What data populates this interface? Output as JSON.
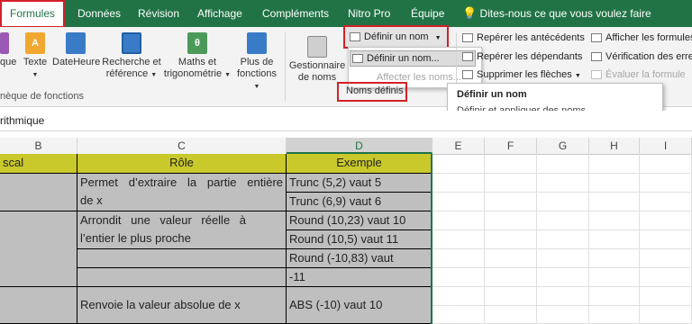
{
  "tabs": [
    "Formules",
    "Données",
    "Révision",
    "Affichage",
    "Compléments",
    "Nitro Pro",
    "Équipe"
  ],
  "tell_me": "Dites-nous ce que vous voulez faire",
  "ribbon": {
    "lib_buttons": [
      "que",
      "Texte",
      "DateHeure",
      "Recherche et",
      "référence",
      "Maths et",
      "trigonométrie",
      "Plus de",
      "fonctions"
    ],
    "lib_group_label": "nèque de fonctions",
    "name_manager": [
      "Gestionnaire",
      "de noms"
    ],
    "define_name": "Définir un nom",
    "define_name_item": "Définir un nom...",
    "apply_names": "Affecter les noms...",
    "defined_names_label": "Noms définis",
    "audit": [
      "Repérer les antécédents",
      "Repérer les dépendants",
      "Supprimer les flèches",
      "Afficher les formules",
      "Vérification des erreurs",
      "Évaluer la formule"
    ]
  },
  "tooltip": {
    "title": "Définir un nom",
    "body": "Définir et appliquer des noms."
  },
  "formula_bar": "rithmique",
  "columns": [
    "B",
    "C",
    "D",
    "E",
    "F",
    "G",
    "H",
    "I"
  ],
  "table": {
    "headers": [
      "scal",
      "Rôle",
      "Exemple"
    ],
    "roles": [
      "Permet d’extraire la partie entière",
      "de x",
      "Arrondit une valeur réelle à",
      "l’entier le plus proche",
      "Renvoie la valeur absolue de x"
    ],
    "examples": [
      "Trunc (5,2) vaut 5",
      "Trunc (6,9) vaut 6",
      "Round (10,23) vaut 10",
      "Round (10,5) vaut 11",
      "Round (-10,83) vaut",
      "-11",
      "ABS (-10) vaut 10"
    ]
  },
  "colors": {
    "excel_green": "#217346",
    "header_yellow": "#c9c92b",
    "gray_cell": "#bfbfbf",
    "highlight_red": "#d32027"
  }
}
